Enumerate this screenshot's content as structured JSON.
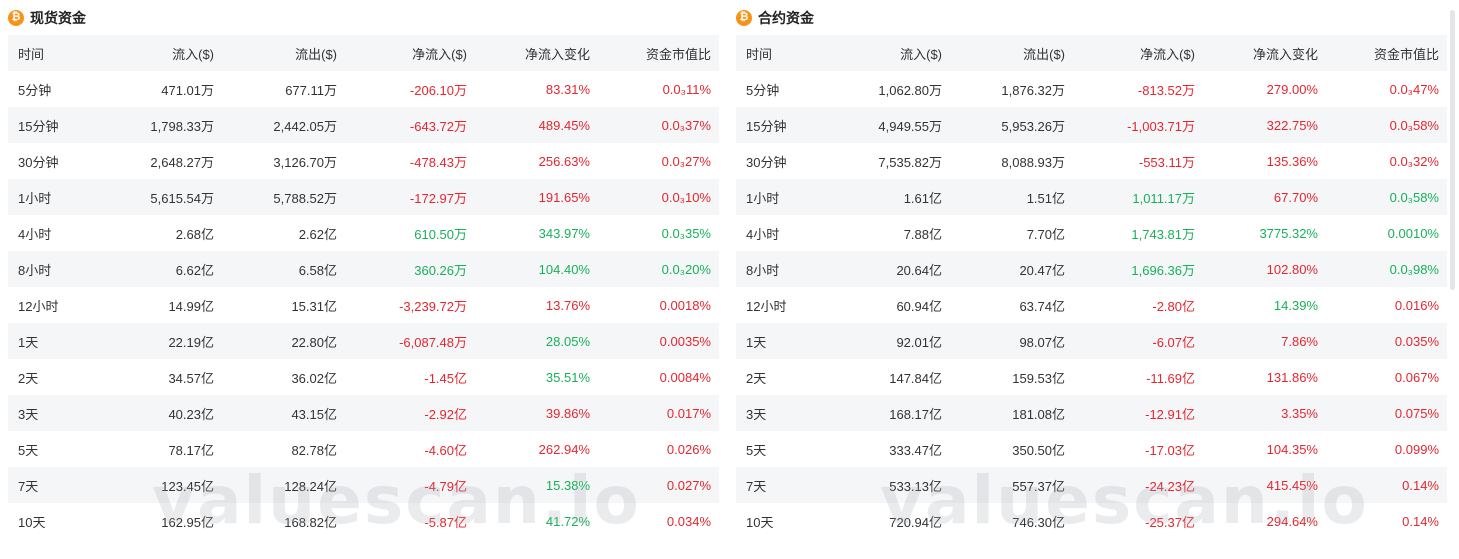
{
  "spot": {
    "title": "现货资金",
    "icon": "bitcoin-icon",
    "headers": [
      "时间",
      "流入($)",
      "流出($)",
      "净流入($)",
      "净流入变化",
      "资金市值比"
    ],
    "rows": [
      [
        "5分钟",
        "471.01万",
        "677.11万",
        "-206.10万",
        "83.31%",
        "0.0₃11%",
        "neg",
        "neg",
        "neg"
      ],
      [
        "15分钟",
        "1,798.33万",
        "2,442.05万",
        "-643.72万",
        "489.45%",
        "0.0₃37%",
        "neg",
        "neg",
        "neg"
      ],
      [
        "30分钟",
        "2,648.27万",
        "3,126.70万",
        "-478.43万",
        "256.63%",
        "0.0₃27%",
        "neg",
        "neg",
        "neg"
      ],
      [
        "1小时",
        "5,615.54万",
        "5,788.52万",
        "-172.97万",
        "191.65%",
        "0.0₃10%",
        "neg",
        "neg",
        "neg"
      ],
      [
        "4小时",
        "2.68亿",
        "2.62亿",
        "610.50万",
        "343.97%",
        "0.0₃35%",
        "pos",
        "pos",
        "pos"
      ],
      [
        "8小时",
        "6.62亿",
        "6.58亿",
        "360.26万",
        "104.40%",
        "0.0₃20%",
        "pos",
        "pos",
        "pos"
      ],
      [
        "12小时",
        "14.99亿",
        "15.31亿",
        "-3,239.72万",
        "13.76%",
        "0.0018%",
        "neg",
        "neg",
        "neg"
      ],
      [
        "1天",
        "22.19亿",
        "22.80亿",
        "-6,087.48万",
        "28.05%",
        "0.0035%",
        "neg",
        "pos",
        "neg"
      ],
      [
        "2天",
        "34.57亿",
        "36.02亿",
        "-1.45亿",
        "35.51%",
        "0.0084%",
        "neg",
        "pos",
        "neg"
      ],
      [
        "3天",
        "40.23亿",
        "43.15亿",
        "-2.92亿",
        "39.86%",
        "0.017%",
        "neg",
        "neg",
        "neg"
      ],
      [
        "5天",
        "78.17亿",
        "82.78亿",
        "-4.60亿",
        "262.94%",
        "0.026%",
        "neg",
        "neg",
        "neg"
      ],
      [
        "7天",
        "123.45亿",
        "128.24亿",
        "-4.79亿",
        "15.38%",
        "0.027%",
        "neg",
        "pos",
        "neg"
      ],
      [
        "10天",
        "162.95亿",
        "168.82亿",
        "-5.87亿",
        "41.72%",
        "0.034%",
        "neg",
        "pos",
        "neg"
      ]
    ]
  },
  "futures": {
    "title": "合约资金",
    "icon": "bitcoin-icon",
    "headers": [
      "时间",
      "流入($)",
      "流出($)",
      "净流入($)",
      "净流入变化",
      "资金市值比"
    ],
    "rows": [
      [
        "5分钟",
        "1,062.80万",
        "1,876.32万",
        "-813.52万",
        "279.00%",
        "0.0₃47%",
        "neg",
        "neg",
        "neg"
      ],
      [
        "15分钟",
        "4,949.55万",
        "5,953.26万",
        "-1,003.71万",
        "322.75%",
        "0.0₃58%",
        "neg",
        "neg",
        "neg"
      ],
      [
        "30分钟",
        "7,535.82万",
        "8,088.93万",
        "-553.11万",
        "135.36%",
        "0.0₃32%",
        "neg",
        "neg",
        "neg"
      ],
      [
        "1小时",
        "1.61亿",
        "1.51亿",
        "1,011.17万",
        "67.70%",
        "0.0₃58%",
        "pos",
        "neg",
        "pos"
      ],
      [
        "4小时",
        "7.88亿",
        "7.70亿",
        "1,743.81万",
        "3775.32%",
        "0.0010%",
        "pos",
        "pos",
        "pos"
      ],
      [
        "8小时",
        "20.64亿",
        "20.47亿",
        "1,696.36万",
        "102.80%",
        "0.0₃98%",
        "pos",
        "neg",
        "pos"
      ],
      [
        "12小时",
        "60.94亿",
        "63.74亿",
        "-2.80亿",
        "14.39%",
        "0.016%",
        "neg",
        "pos",
        "neg"
      ],
      [
        "1天",
        "92.01亿",
        "98.07亿",
        "-6.07亿",
        "7.86%",
        "0.035%",
        "neg",
        "neg",
        "neg"
      ],
      [
        "2天",
        "147.84亿",
        "159.53亿",
        "-11.69亿",
        "131.86%",
        "0.067%",
        "neg",
        "neg",
        "neg"
      ],
      [
        "3天",
        "168.17亿",
        "181.08亿",
        "-12.91亿",
        "3.35%",
        "0.075%",
        "neg",
        "neg",
        "neg"
      ],
      [
        "5天",
        "333.47亿",
        "350.50亿",
        "-17.03亿",
        "104.35%",
        "0.099%",
        "neg",
        "neg",
        "neg"
      ],
      [
        "7天",
        "533.13亿",
        "557.37亿",
        "-24.23亿",
        "415.45%",
        "0.14%",
        "neg",
        "neg",
        "neg"
      ],
      [
        "10天",
        "720.94亿",
        "746.30亿",
        "-25.37亿",
        "294.64%",
        "0.14%",
        "neg",
        "neg",
        "neg"
      ]
    ]
  },
  "watermark": "valuescan.io",
  "colors": {
    "negative": "#e5262f",
    "positive": "#18b05a",
    "bitcoin": "#f7931a",
    "stripe": "#f5f6f8"
  }
}
